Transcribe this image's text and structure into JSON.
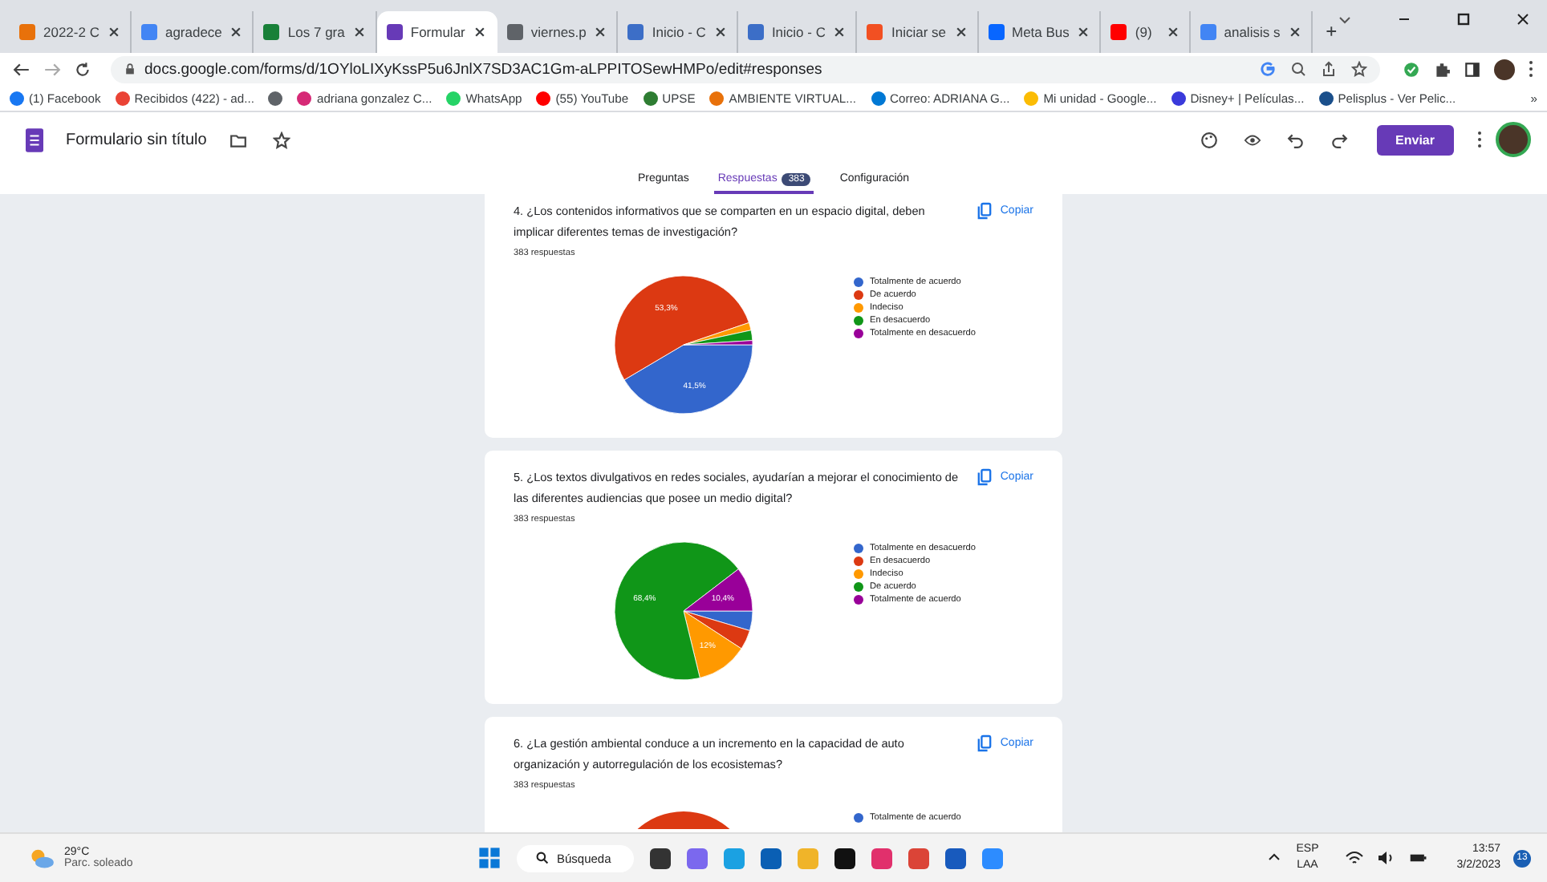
{
  "tabs": [
    {
      "title": "2022-2 C",
      "selected": false,
      "color": "#e8710a"
    },
    {
      "title": "agradece",
      "selected": false,
      "color": "#4285f4"
    },
    {
      "title": "Los 7 gra",
      "selected": false,
      "color": "#188038"
    },
    {
      "title": "Formular",
      "selected": true,
      "color": "#673ab7"
    },
    {
      "title": "viernes.p",
      "selected": false,
      "color": "#5f6368"
    },
    {
      "title": "Inicio - C",
      "selected": false,
      "color": "#3c6ec7"
    },
    {
      "title": "Inicio - C",
      "selected": false,
      "color": "#3c6ec7"
    },
    {
      "title": "Iniciar se",
      "selected": false,
      "color": "#f25022"
    },
    {
      "title": "Meta Bus",
      "selected": false,
      "color": "#0866ff"
    },
    {
      "title": "(9)",
      "selected": false,
      "color": "#ff0000"
    },
    {
      "title": "analisis s",
      "selected": false,
      "color": "#4285f4"
    }
  ],
  "address": "docs.google.com/forms/d/1OYloLIXyKssP5u6JnlX7SD3AC1Gm-aLPPITOSewHMPo/edit#responses",
  "bookmarks": [
    {
      "label": "(1) Facebook",
      "color": "#1877f2"
    },
    {
      "label": "Recibidos (422) - ad...",
      "color": "#ea4335"
    },
    {
      "color": "#5f6368"
    },
    {
      "label": "adriana gonzalez C...",
      "color": "#d62976"
    },
    {
      "label": "WhatsApp",
      "color": "#25d366"
    },
    {
      "label": "(55) YouTube",
      "color": "#ff0000"
    },
    {
      "label": "UPSE",
      "color": "#2e7d32"
    },
    {
      "label": "AMBIENTE VIRTUAL...",
      "color": "#e8710a"
    },
    {
      "label": "Correo: ADRIANA G...",
      "color": "#0078d4"
    },
    {
      "label": "Mi unidad - Google...",
      "color": "#fbbc04"
    },
    {
      "label": "Disney+ | Películas...",
      "color": "#3a3adb"
    },
    {
      "label": "Pelisplus - Ver Pelic...",
      "color": "#1a4f8b"
    }
  ],
  "bookmarks_more": "»",
  "form": {
    "title": "Formulario sin título",
    "send": "Enviar"
  },
  "subtabs": [
    {
      "label": "Preguntas",
      "selected": false
    },
    {
      "label": "Respuestas",
      "selected": true,
      "badge": "383"
    },
    {
      "label": "Configuración",
      "selected": false
    }
  ],
  "questions": [
    {
      "title": "4.  ¿Los contenidos informativos que se comparten en un espacio digital, deben implicar diferentes temas de investigación?",
      "count": "383 respuestas",
      "copy": "Copiar",
      "chart_data": {
        "type": "pie",
        "categories": [
          "Totalmente de acuerdo",
          "De acuerdo",
          "Indeciso",
          "En desacuerdo",
          "Totalmente en desacuerdo"
        ],
        "values": [
          41.5,
          53.3,
          1.8,
          2.4,
          1.0
        ],
        "colors": [
          "#3366cc",
          "#dc3912",
          "#ff9900",
          "#109618",
          "#990099"
        ],
        "value_labels": [
          "41,5%",
          "53,3%",
          null,
          null,
          null
        ],
        "legend": "right"
      }
    },
    {
      "title": "5.  ¿Los textos divulgativos en redes sociales, ayudarían a mejorar el conocimiento de las diferentes audiencias que posee un medio digital?",
      "count": "383 respuestas",
      "copy": "Copiar",
      "chart_data": {
        "type": "pie",
        "categories": [
          "Totalmente en desacuerdo",
          "En desacuerdo",
          "Indeciso",
          "De acuerdo",
          "Totalmente de acuerdo"
        ],
        "values": [
          4.6,
          4.6,
          12,
          68.4,
          10.4
        ],
        "colors": [
          "#3366cc",
          "#dc3912",
          "#ff9900",
          "#109618",
          "#990099"
        ],
        "value_labels": [
          null,
          null,
          "12%",
          "68,4%",
          "10,4%"
        ],
        "legend": "right"
      }
    },
    {
      "title": "6.  ¿La gestión ambiental conduce a un incremento en la capacidad de auto organización y autorregulación de los ecosistemas?",
      "count": "383 respuestas",
      "copy": "Copiar",
      "legend": [
        {
          "label": "Totalmente de acuerdo",
          "color": "#3366cc"
        }
      ]
    }
  ],
  "taskbar": {
    "temp": "29°C",
    "weather": "Parc. soleado",
    "search": "Búsqueda",
    "apps": [
      {
        "color": "#333333"
      },
      {
        "color": "#7b68ee"
      },
      {
        "color": "#1ba1e2"
      },
      {
        "color": "#0a5fb4"
      },
      {
        "color": "#f0b429"
      },
      {
        "color": "#111111"
      },
      {
        "color": "#e1306c"
      },
      {
        "color": "#db4437"
      },
      {
        "color": "#185abd"
      },
      {
        "color": "#2d8cff"
      }
    ],
    "lang": "ESP",
    "layout": "LAA",
    "time": "13:57",
    "date": "3/2/2023",
    "notifications": "13"
  }
}
